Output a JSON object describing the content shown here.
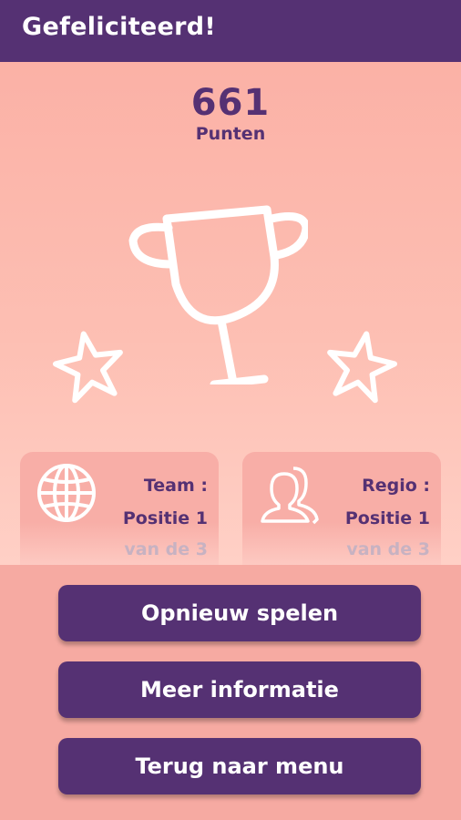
{
  "header": {
    "title": "Gefeliciteerd!"
  },
  "result": {
    "score": "661",
    "score_label": "Punten"
  },
  "icons": {
    "trophy": "trophy-icon",
    "star": "star-icon",
    "globe": "globe-icon",
    "users": "users-icon"
  },
  "cards": {
    "team": {
      "label": "Team :",
      "position": "Positie 1",
      "of": "van de 3"
    },
    "regio": {
      "label": "Regio :",
      "position": "Positie 1",
      "of": "van de 3"
    }
  },
  "buttons": {
    "play_again": "Opnieuw spelen",
    "more_info": "Meer informatie",
    "back_to_menu": "Terug naar menu"
  },
  "colors": {
    "primary": "#553173",
    "background": "#f6aaa2",
    "white": "#ffffff"
  }
}
